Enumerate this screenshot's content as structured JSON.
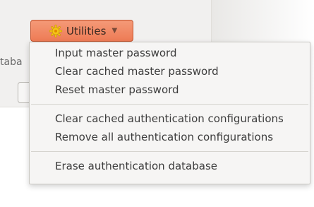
{
  "utilities_button": {
    "label": "Utilities",
    "icon": "gear-icon",
    "caret_icon": "caret-down-icon"
  },
  "background": {
    "side_label_fragment": "taba"
  },
  "menu": {
    "group1": [
      {
        "label": "Input master password"
      },
      {
        "label": "Clear cached master password"
      },
      {
        "label": "Reset master password"
      }
    ],
    "group2": [
      {
        "label": "Clear cached authentication configurations"
      },
      {
        "label": "Remove all authentication configurations"
      }
    ],
    "group3": [
      {
        "label": "Erase authentication database"
      }
    ]
  },
  "colors": {
    "button_accent": "#ee7b55",
    "menu_background": "#f6f5f4",
    "text": "#3c3c3c"
  }
}
